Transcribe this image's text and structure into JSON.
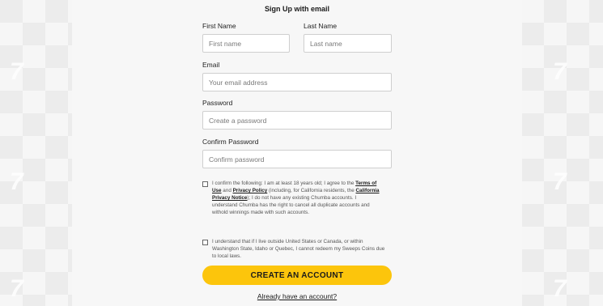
{
  "background": {
    "logo_glyph": "7"
  },
  "form": {
    "title": "Sign Up with email",
    "first_name": {
      "label": "First Name",
      "placeholder": "First name"
    },
    "last_name": {
      "label": "Last Name",
      "placeholder": "Last name"
    },
    "email": {
      "label": "Email",
      "placeholder": "Your email address"
    },
    "password": {
      "label": "Password",
      "placeholder": "Create a password"
    },
    "confirm_password": {
      "label": "Confirm Password",
      "placeholder": "Confirm password"
    },
    "consent1": {
      "text_1": "I confirm the following: I am at least 18 years old; I agree to the ",
      "terms_link": "Terms of Use",
      "text_2": " and ",
      "privacy_link": "Privacy Policy",
      "text_3": " (including, for California residents, the ",
      "ca_privacy_link": "California Privacy Notice",
      "text_4": "); I do not have any existing Chumba accounts. I understand Chumba has the right to cancel all duplicate accounts and withold winnings made with such accounts.",
      "checked": false
    },
    "consent2": {
      "text": "I understand that if I live outside United States or Canada, or within Washington State, Idaho or Quebec, I cannot redeem my Sweeps Coins due to local laws.",
      "checked": false
    },
    "create_button": "CREATE AN ACCOUNT",
    "signin_link": "Already have an account?"
  },
  "colors": {
    "accent": "#fcc50c",
    "panel": "#f7f7f7"
  }
}
